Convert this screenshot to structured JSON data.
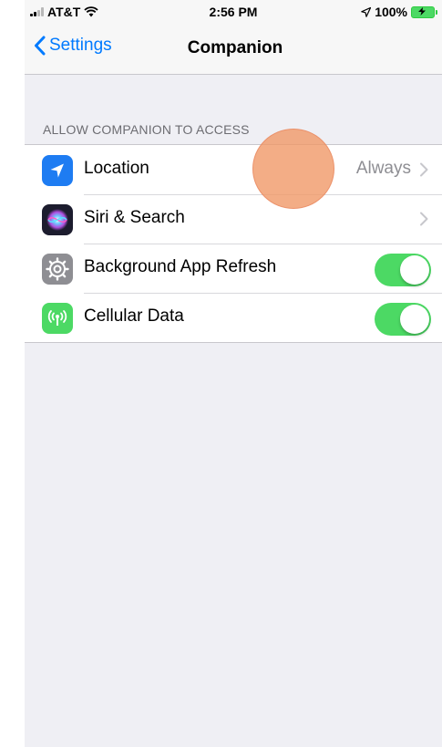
{
  "status_bar": {
    "carrier": "AT&T",
    "time": "2:56 PM",
    "battery": "100%",
    "icons": [
      "signal-bars-icon",
      "wifi-icon",
      "location-arrow-icon",
      "battery-charging-icon"
    ]
  },
  "nav": {
    "back_label": "Settings",
    "title": "Companion"
  },
  "section": {
    "header": "ALLOW COMPANION TO ACCESS"
  },
  "rows": [
    {
      "label": "Location",
      "detail": "Always",
      "icon": "location-icon",
      "icon_color": "#1e7cf2",
      "type": "disclosure"
    },
    {
      "label": "Siri & Search",
      "detail": "",
      "icon": "siri-icon",
      "icon_color": "#1c1c2e",
      "type": "disclosure"
    },
    {
      "label": "Background App Refresh",
      "icon": "gear-icon",
      "icon_color": "#8e8e93",
      "type": "toggle",
      "on": true
    },
    {
      "label": "Cellular Data",
      "icon": "antenna-icon",
      "icon_color": "#4cd964",
      "type": "toggle",
      "on": true
    }
  ],
  "colors": {
    "accent": "#007aff",
    "toggle_on": "#4cd964",
    "background": "#efeff4"
  }
}
